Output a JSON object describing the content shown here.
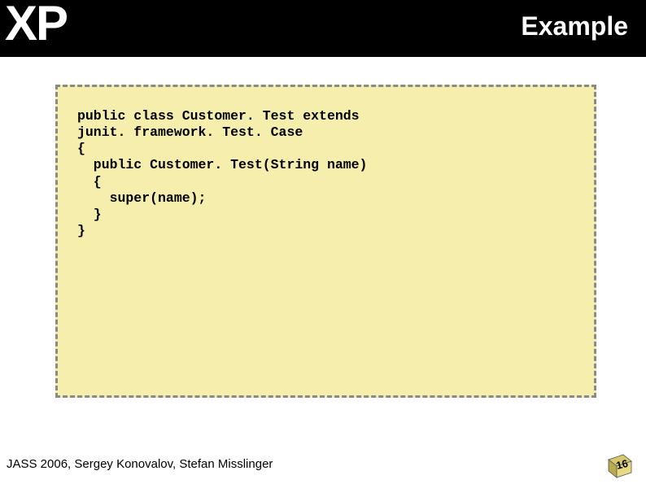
{
  "header": {
    "logo": "XP",
    "title": "Example"
  },
  "code": {
    "lines": [
      "public class Customer. Test extends",
      "junit. framework. Test. Case",
      "{",
      "  public Customer. Test(String name)",
      "  {",
      "    super(name);",
      "  }",
      "}"
    ]
  },
  "footer": {
    "text": "JASS 2006, Sergey Konovalov, Stefan Misslinger",
    "page_number": "16"
  }
}
